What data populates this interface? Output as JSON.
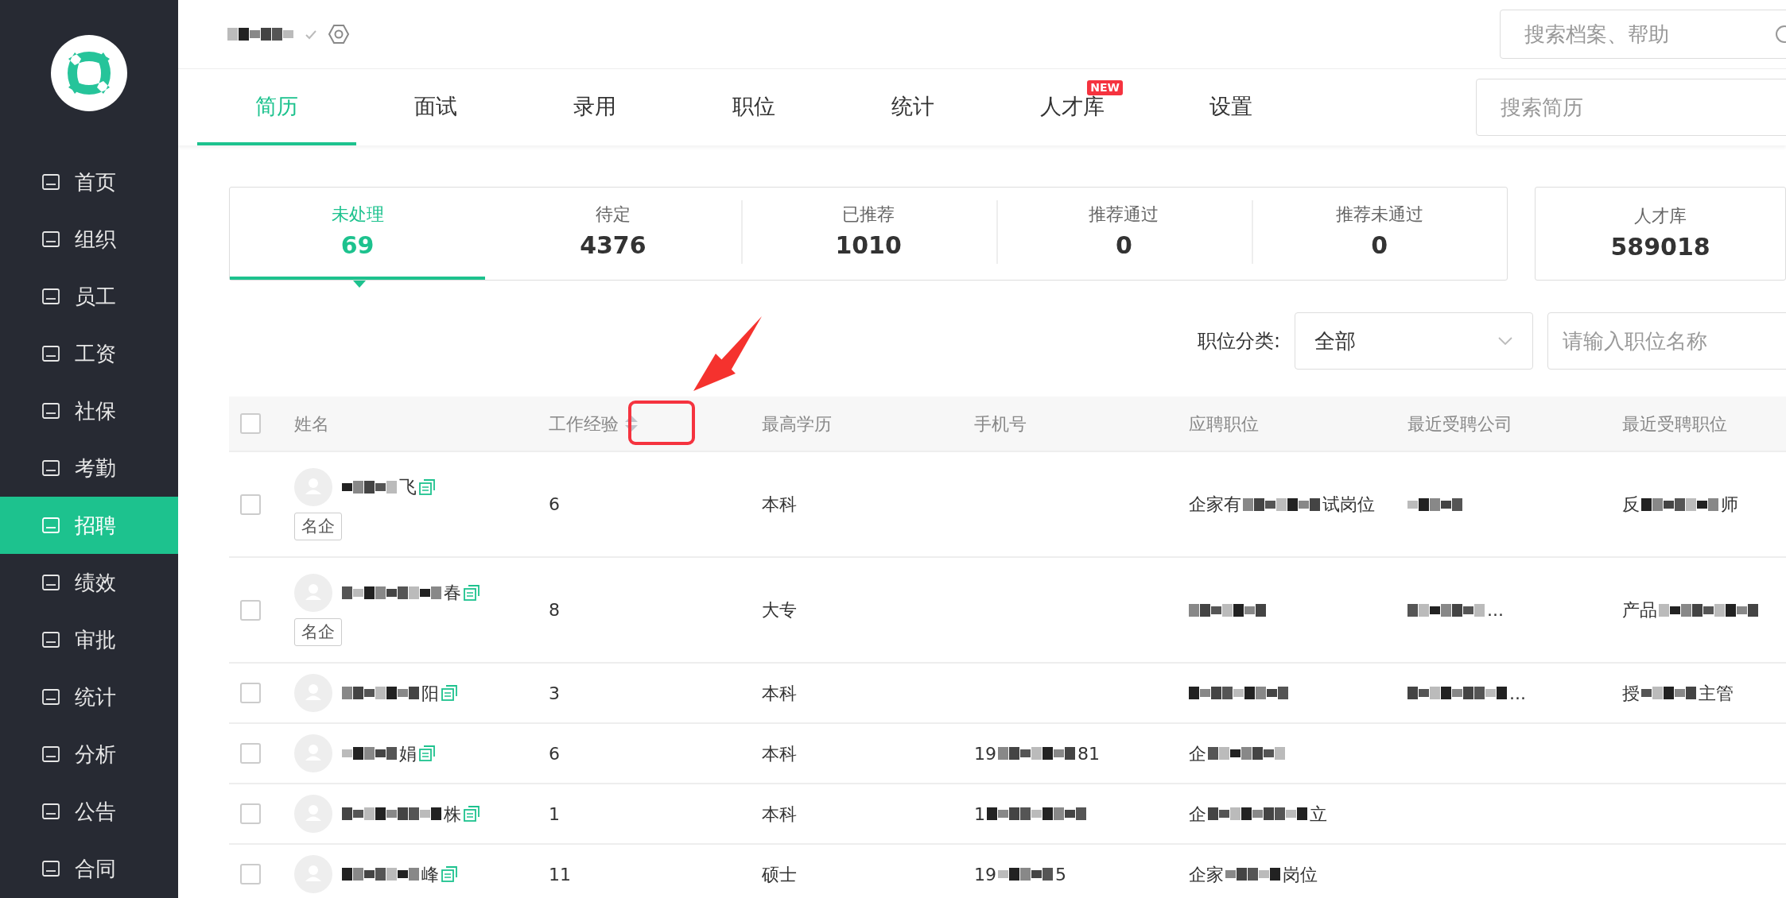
{
  "sidebar": {
    "items": [
      {
        "label": "首页",
        "selected": false
      },
      {
        "label": "组织",
        "selected": false
      },
      {
        "label": "员工",
        "selected": false
      },
      {
        "label": "工资",
        "selected": false
      },
      {
        "label": "社保",
        "selected": false
      },
      {
        "label": "考勤",
        "selected": false
      },
      {
        "label": "招聘",
        "selected": true
      },
      {
        "label": "绩效",
        "selected": false
      },
      {
        "label": "审批",
        "selected": false
      },
      {
        "label": "统计",
        "selected": false
      },
      {
        "label": "分析",
        "selected": false
      },
      {
        "label": "公告",
        "selected": false
      },
      {
        "label": "合同",
        "selected": false
      }
    ]
  },
  "header": {
    "search": {
      "placeholder": "搜索档案、帮助"
    }
  },
  "tabs": [
    {
      "label": "简历",
      "selected": true
    },
    {
      "label": "面试",
      "selected": false
    },
    {
      "label": "录用",
      "selected": false
    },
    {
      "label": "职位",
      "selected": false
    },
    {
      "label": "统计",
      "selected": false
    },
    {
      "label": "人才库",
      "selected": false,
      "badge": "NEW"
    },
    {
      "label": "设置",
      "selected": false
    }
  ],
  "resume_search": {
    "placeholder": "搜索简历"
  },
  "stats": [
    {
      "label": "未处理",
      "count": "69",
      "selected": true
    },
    {
      "label": "待定",
      "count": "4376",
      "selected": false
    },
    {
      "label": "已推荐",
      "count": "1010",
      "selected": false
    },
    {
      "label": "推荐通过",
      "count": "0",
      "selected": false
    },
    {
      "label": "推荐未通过",
      "count": "0",
      "selected": false
    }
  ],
  "talent_pool": {
    "label": "人才库",
    "count": "589018"
  },
  "filter": {
    "label": "职位分类:",
    "select_value": "全部",
    "input_placeholder": "请输入职位名称"
  },
  "table": {
    "select_all_checked": false,
    "columns": [
      {
        "label": "姓名",
        "sortable": false
      },
      {
        "label": "工作经验",
        "sortable": true
      },
      {
        "label": "最高学历",
        "sortable": false
      },
      {
        "label": "手机号",
        "sortable": false
      },
      {
        "label": "应聘职位",
        "sortable": false
      },
      {
        "label": "最近受聘公司",
        "sortable": false
      },
      {
        "label": "最近受聘职位",
        "sortable": false
      }
    ],
    "rows": [
      {
        "checked": false,
        "name": [
          {
            "kind": "blur"
          },
          {
            "kind": "text",
            "text": "飞"
          }
        ],
        "tag": "名企",
        "experience": "6",
        "education": "本科",
        "phone": [],
        "position": [
          {
            "kind": "text",
            "text": "企家有"
          },
          {
            "kind": "blur"
          },
          {
            "kind": "text",
            "text": "试岗位"
          }
        ],
        "company": [
          {
            "kind": "blur"
          }
        ],
        "recent_position": [
          {
            "kind": "text",
            "text": "反"
          },
          {
            "kind": "blur"
          },
          {
            "kind": "text",
            "text": "师"
          }
        ]
      },
      {
        "checked": false,
        "name": [
          {
            "kind": "blur"
          },
          {
            "kind": "text",
            "text": "春"
          }
        ],
        "tag": "名企",
        "experience": "8",
        "education": "大专",
        "phone": [],
        "position": [
          {
            "kind": "blur"
          }
        ],
        "company": [
          {
            "kind": "blur"
          },
          {
            "kind": "text",
            "text": "..."
          }
        ],
        "recent_position": [
          {
            "kind": "text",
            "text": "产品"
          },
          {
            "kind": "blur"
          }
        ]
      },
      {
        "checked": false,
        "name": [
          {
            "kind": "blur"
          },
          {
            "kind": "text",
            "text": "阳"
          }
        ],
        "experience": "3",
        "education": "本科",
        "phone": [],
        "position": [
          {
            "kind": "blur"
          }
        ],
        "company": [
          {
            "kind": "blur"
          },
          {
            "kind": "text",
            "text": "..."
          }
        ],
        "recent_position": [
          {
            "kind": "text",
            "text": "授"
          },
          {
            "kind": "blur"
          },
          {
            "kind": "text",
            "text": "主管"
          }
        ]
      },
      {
        "checked": false,
        "name": [
          {
            "kind": "blur"
          },
          {
            "kind": "text",
            "text": "娟"
          }
        ],
        "experience": "6",
        "education": "本科",
        "phone": [
          {
            "kind": "text",
            "text": "19"
          },
          {
            "kind": "blur"
          },
          {
            "kind": "text",
            "text": "81"
          }
        ],
        "position": [
          {
            "kind": "text",
            "text": "企"
          },
          {
            "kind": "blur"
          }
        ],
        "company": [],
        "recent_position": []
      },
      {
        "checked": false,
        "name": [
          {
            "kind": "blur"
          },
          {
            "kind": "text",
            "text": "株"
          }
        ],
        "experience": "1",
        "education": "本科",
        "phone": [
          {
            "kind": "text",
            "text": "1"
          },
          {
            "kind": "blur"
          }
        ],
        "position": [
          {
            "kind": "text",
            "text": "企"
          },
          {
            "kind": "blur"
          },
          {
            "kind": "text",
            "text": "立"
          }
        ],
        "company": [],
        "recent_position": []
      },
      {
        "checked": false,
        "name": [
          {
            "kind": "blur"
          },
          {
            "kind": "text",
            "text": "峰"
          }
        ],
        "experience": "11",
        "education": "硕士",
        "phone": [
          {
            "kind": "text",
            "text": "19"
          },
          {
            "kind": "blur"
          },
          {
            "kind": "text",
            "text": "5"
          }
        ],
        "position": [
          {
            "kind": "text",
            "text": "企家"
          },
          {
            "kind": "blur"
          },
          {
            "kind": "text",
            "text": "岗位"
          }
        ],
        "company": [],
        "recent_position": []
      }
    ]
  }
}
